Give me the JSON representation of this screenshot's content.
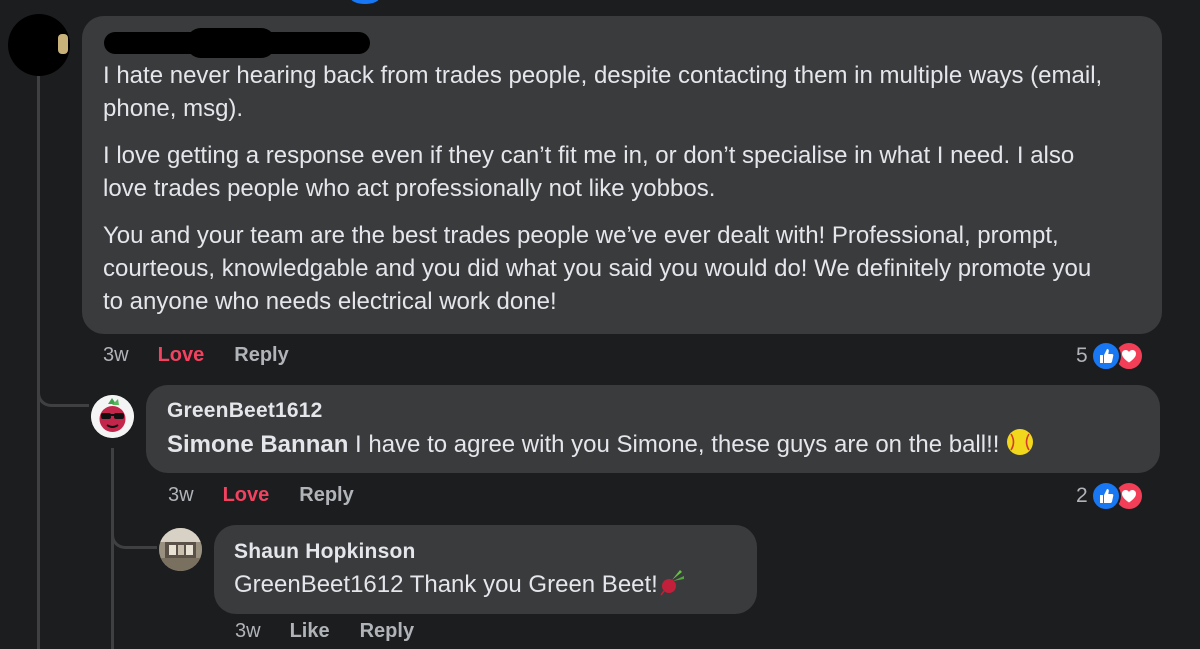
{
  "colors": {
    "background": "#1c1d1f",
    "bubble": "#3a3b3c",
    "text": "#e4e6eb",
    "muted": "#b0b3b8",
    "love": "#f3425f",
    "like_blue": "#1877f2",
    "thread_line": "#3e4042"
  },
  "comments": [
    {
      "author": "",
      "author_redacted": true,
      "paragraphs": [
        "I hate never hearing back from trades people, despite contacting them in multiple ways (email, phone, msg).",
        "I love getting a response even if they can’t fit me in, or don’t specialise in what I need. I also love trades people who act professionally not like yobbos.",
        "You and your team are the best trades people we’ve ever dealt with! Professional, prompt, courteous, knowledgable and you did what you said you would do! We definitely promote you to anyone who needs electrical work done!"
      ],
      "time": "3w",
      "reacted_label": "Love",
      "reply_label": "Reply",
      "reaction_count": "5",
      "reaction_icons": [
        "like-icon",
        "love-icon"
      ]
    },
    {
      "author": "GreenBeet1612",
      "mention": "Simone Bannan",
      "text": " I have to agree with you Simone, these guys are on the ball!!",
      "trailing_emoji": "softball-icon",
      "time": "3w",
      "reacted_label": "Love",
      "reply_label": "Reply",
      "reaction_count": "2",
      "reaction_icons": [
        "like-icon",
        "love-icon"
      ]
    },
    {
      "author": "Shaun Hopkinson",
      "text": "GreenBeet1612 Thank you Green Beet!",
      "trailing_emoji": "beet-icon",
      "time": "3w",
      "like_label": "Like",
      "reply_label": "Reply"
    }
  ]
}
